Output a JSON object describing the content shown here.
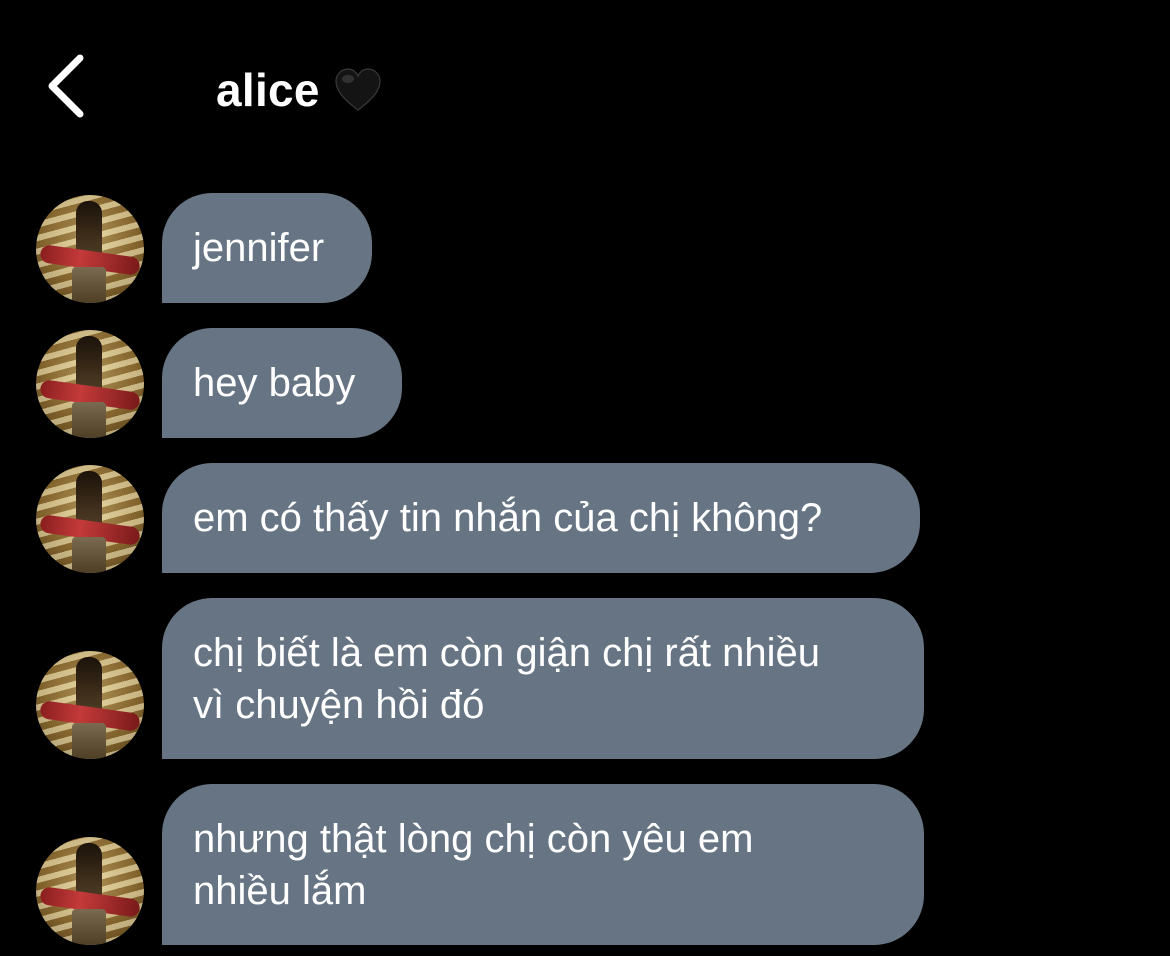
{
  "header": {
    "title": "alice",
    "title_emoji_icon": "black-heart-icon",
    "back_icon": "chevron-left-icon"
  },
  "colors": {
    "background": "#000000",
    "bubble": "#677483",
    "text": "#ffffff"
  },
  "messages": [
    {
      "lines": [
        "jennifer"
      ]
    },
    {
      "lines": [
        "hey baby"
      ]
    },
    {
      "lines": [
        "em có thấy tin nhắn của chị không?"
      ]
    },
    {
      "lines": [
        "chị biết là em còn giận chị rất nhiều",
        "vì chuyện hồi đó"
      ]
    },
    {
      "lines": [
        "nhưng thật lòng chị còn yêu em",
        "nhiều lắm"
      ]
    }
  ]
}
